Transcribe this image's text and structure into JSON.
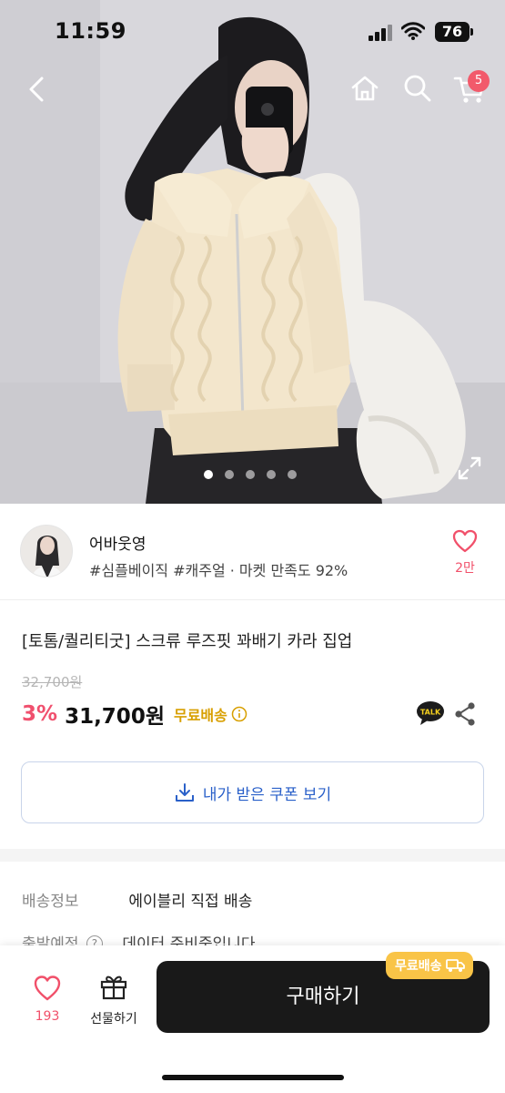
{
  "status_bar": {
    "time": "11:59",
    "battery": "76"
  },
  "nav": {
    "cart_count": "5"
  },
  "gallery": {
    "slide_count": 5,
    "active_index": 0
  },
  "seller": {
    "name": "어바웃영",
    "tags": "#심플베이직 #캐주얼 · 마켓 만족도 92%",
    "like_count": "2만"
  },
  "product": {
    "title": "[토톰/퀄리티굿] 스크류 루즈핏 꽈배기 카라 집업",
    "original_price": "32,700원",
    "discount": "3%",
    "price": "31,700원",
    "free_shipping": "무료배송"
  },
  "coupon": {
    "label": "내가 받은 쿠폰 보기"
  },
  "shipping": {
    "label": "배송정보",
    "value": "에이블리 직접 배송",
    "departure_label": "출발예정",
    "departure_value": "데이터 준비중입니다"
  },
  "bottom_bar": {
    "like_count": "193",
    "gift_label": "선물하기",
    "buy_label": "구매하기",
    "free_badge": "무료배송"
  },
  "colors": {
    "accent_pink": "#f1506a",
    "coupon_blue": "#2a60c9",
    "ship_gold": "#d89f00",
    "badge_yellow": "#f9c447"
  }
}
